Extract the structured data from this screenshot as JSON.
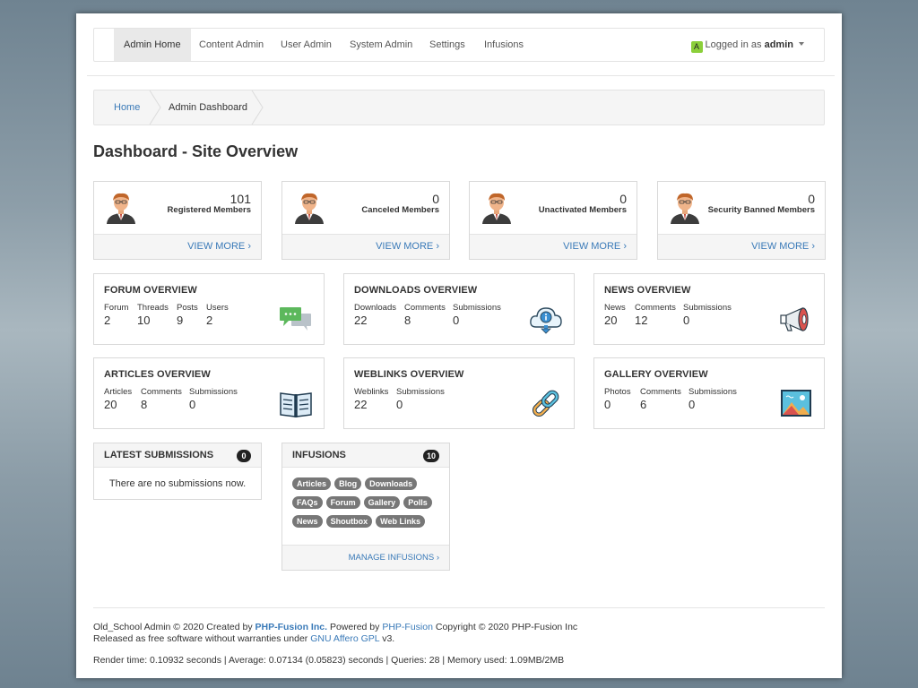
{
  "nav": {
    "items": [
      {
        "label": "Admin Home",
        "active": true
      },
      {
        "label": "Content Admin",
        "active": false
      },
      {
        "label": "User Admin",
        "active": false
      },
      {
        "label": "System Admin",
        "active": false
      },
      {
        "label": "Settings",
        "active": false
      },
      {
        "label": "Infusions",
        "active": false
      }
    ],
    "user_badge": "A",
    "user_prefix": "Logged in as",
    "username": "admin"
  },
  "breadcrumb": {
    "home": "Home",
    "current": "Admin Dashboard"
  },
  "page_title": "Dashboard - Site Overview",
  "members": [
    {
      "count": "101",
      "label": "Registered Members",
      "more": "VIEW MORE"
    },
    {
      "count": "0",
      "label": "Canceled Members",
      "more": "VIEW MORE"
    },
    {
      "count": "0",
      "label": "Unactivated Members",
      "more": "VIEW MORE"
    },
    {
      "count": "0",
      "label": "Security Banned Members",
      "more": "VIEW MORE"
    }
  ],
  "overviews": {
    "forum": {
      "title": "FORUM OVERVIEW",
      "stats": [
        {
          "label": "Forum",
          "value": "2"
        },
        {
          "label": "Threads",
          "value": "10"
        },
        {
          "label": "Posts",
          "value": "9"
        },
        {
          "label": "Users",
          "value": "2"
        }
      ]
    },
    "downloads": {
      "title": "DOWNLOADS OVERVIEW",
      "stats": [
        {
          "label": "Downloads",
          "value": "22"
        },
        {
          "label": "Comments",
          "value": "8"
        },
        {
          "label": "Submissions",
          "value": "0"
        }
      ]
    },
    "news": {
      "title": "NEWS OVERVIEW",
      "stats": [
        {
          "label": "News",
          "value": "20"
        },
        {
          "label": "Comments",
          "value": "12"
        },
        {
          "label": "Submissions",
          "value": "0"
        }
      ]
    },
    "articles": {
      "title": "ARTICLES OVERVIEW",
      "stats": [
        {
          "label": "Articles",
          "value": "20"
        },
        {
          "label": "Comments",
          "value": "8"
        },
        {
          "label": "Submissions",
          "value": "0"
        }
      ]
    },
    "weblinks": {
      "title": "WEBLINKS OVERVIEW",
      "stats": [
        {
          "label": "Weblinks",
          "value": "22"
        },
        {
          "label": "Submissions",
          "value": "0"
        }
      ]
    },
    "gallery": {
      "title": "GALLERY OVERVIEW",
      "stats": [
        {
          "label": "Photos",
          "value": "0"
        },
        {
          "label": "Comments",
          "value": "6"
        },
        {
          "label": "Submissions",
          "value": "0"
        }
      ]
    }
  },
  "latest_submissions": {
    "title": "LATEST SUBMISSIONS",
    "count": "0",
    "empty": "There are no submissions now."
  },
  "infusions": {
    "title": "INFUSIONS",
    "count": "10",
    "tags": [
      "Articles",
      "Blog",
      "Downloads",
      "FAQs",
      "Forum",
      "Gallery",
      "Polls",
      "News",
      "Shoutbox",
      "Web Links"
    ],
    "manage": "MANAGE INFUSIONS"
  },
  "footer": {
    "l1_a": "Old_School Admin © 2020 Created by",
    "l1_link1": "PHP-Fusion Inc.",
    "l1_b": "Powered by",
    "l1_link2": "PHP-Fusion",
    "l1_c": "Copyright © 2020 PHP-Fusion Inc",
    "l2_a": "Released as free software without warranties under",
    "l2_link": "GNU Affero GPL",
    "l2_b": "v3.",
    "render": "Render time: 0.10932 seconds | Average: 0.07134 (0.05823) seconds | Queries: 28 | Memory used: 1.09MB/2MB"
  },
  "colors": {
    "link": "#3a7ab8",
    "badge_bg": "#222222",
    "tag_bg": "#777777",
    "user_badge": "#8bcf3a"
  }
}
